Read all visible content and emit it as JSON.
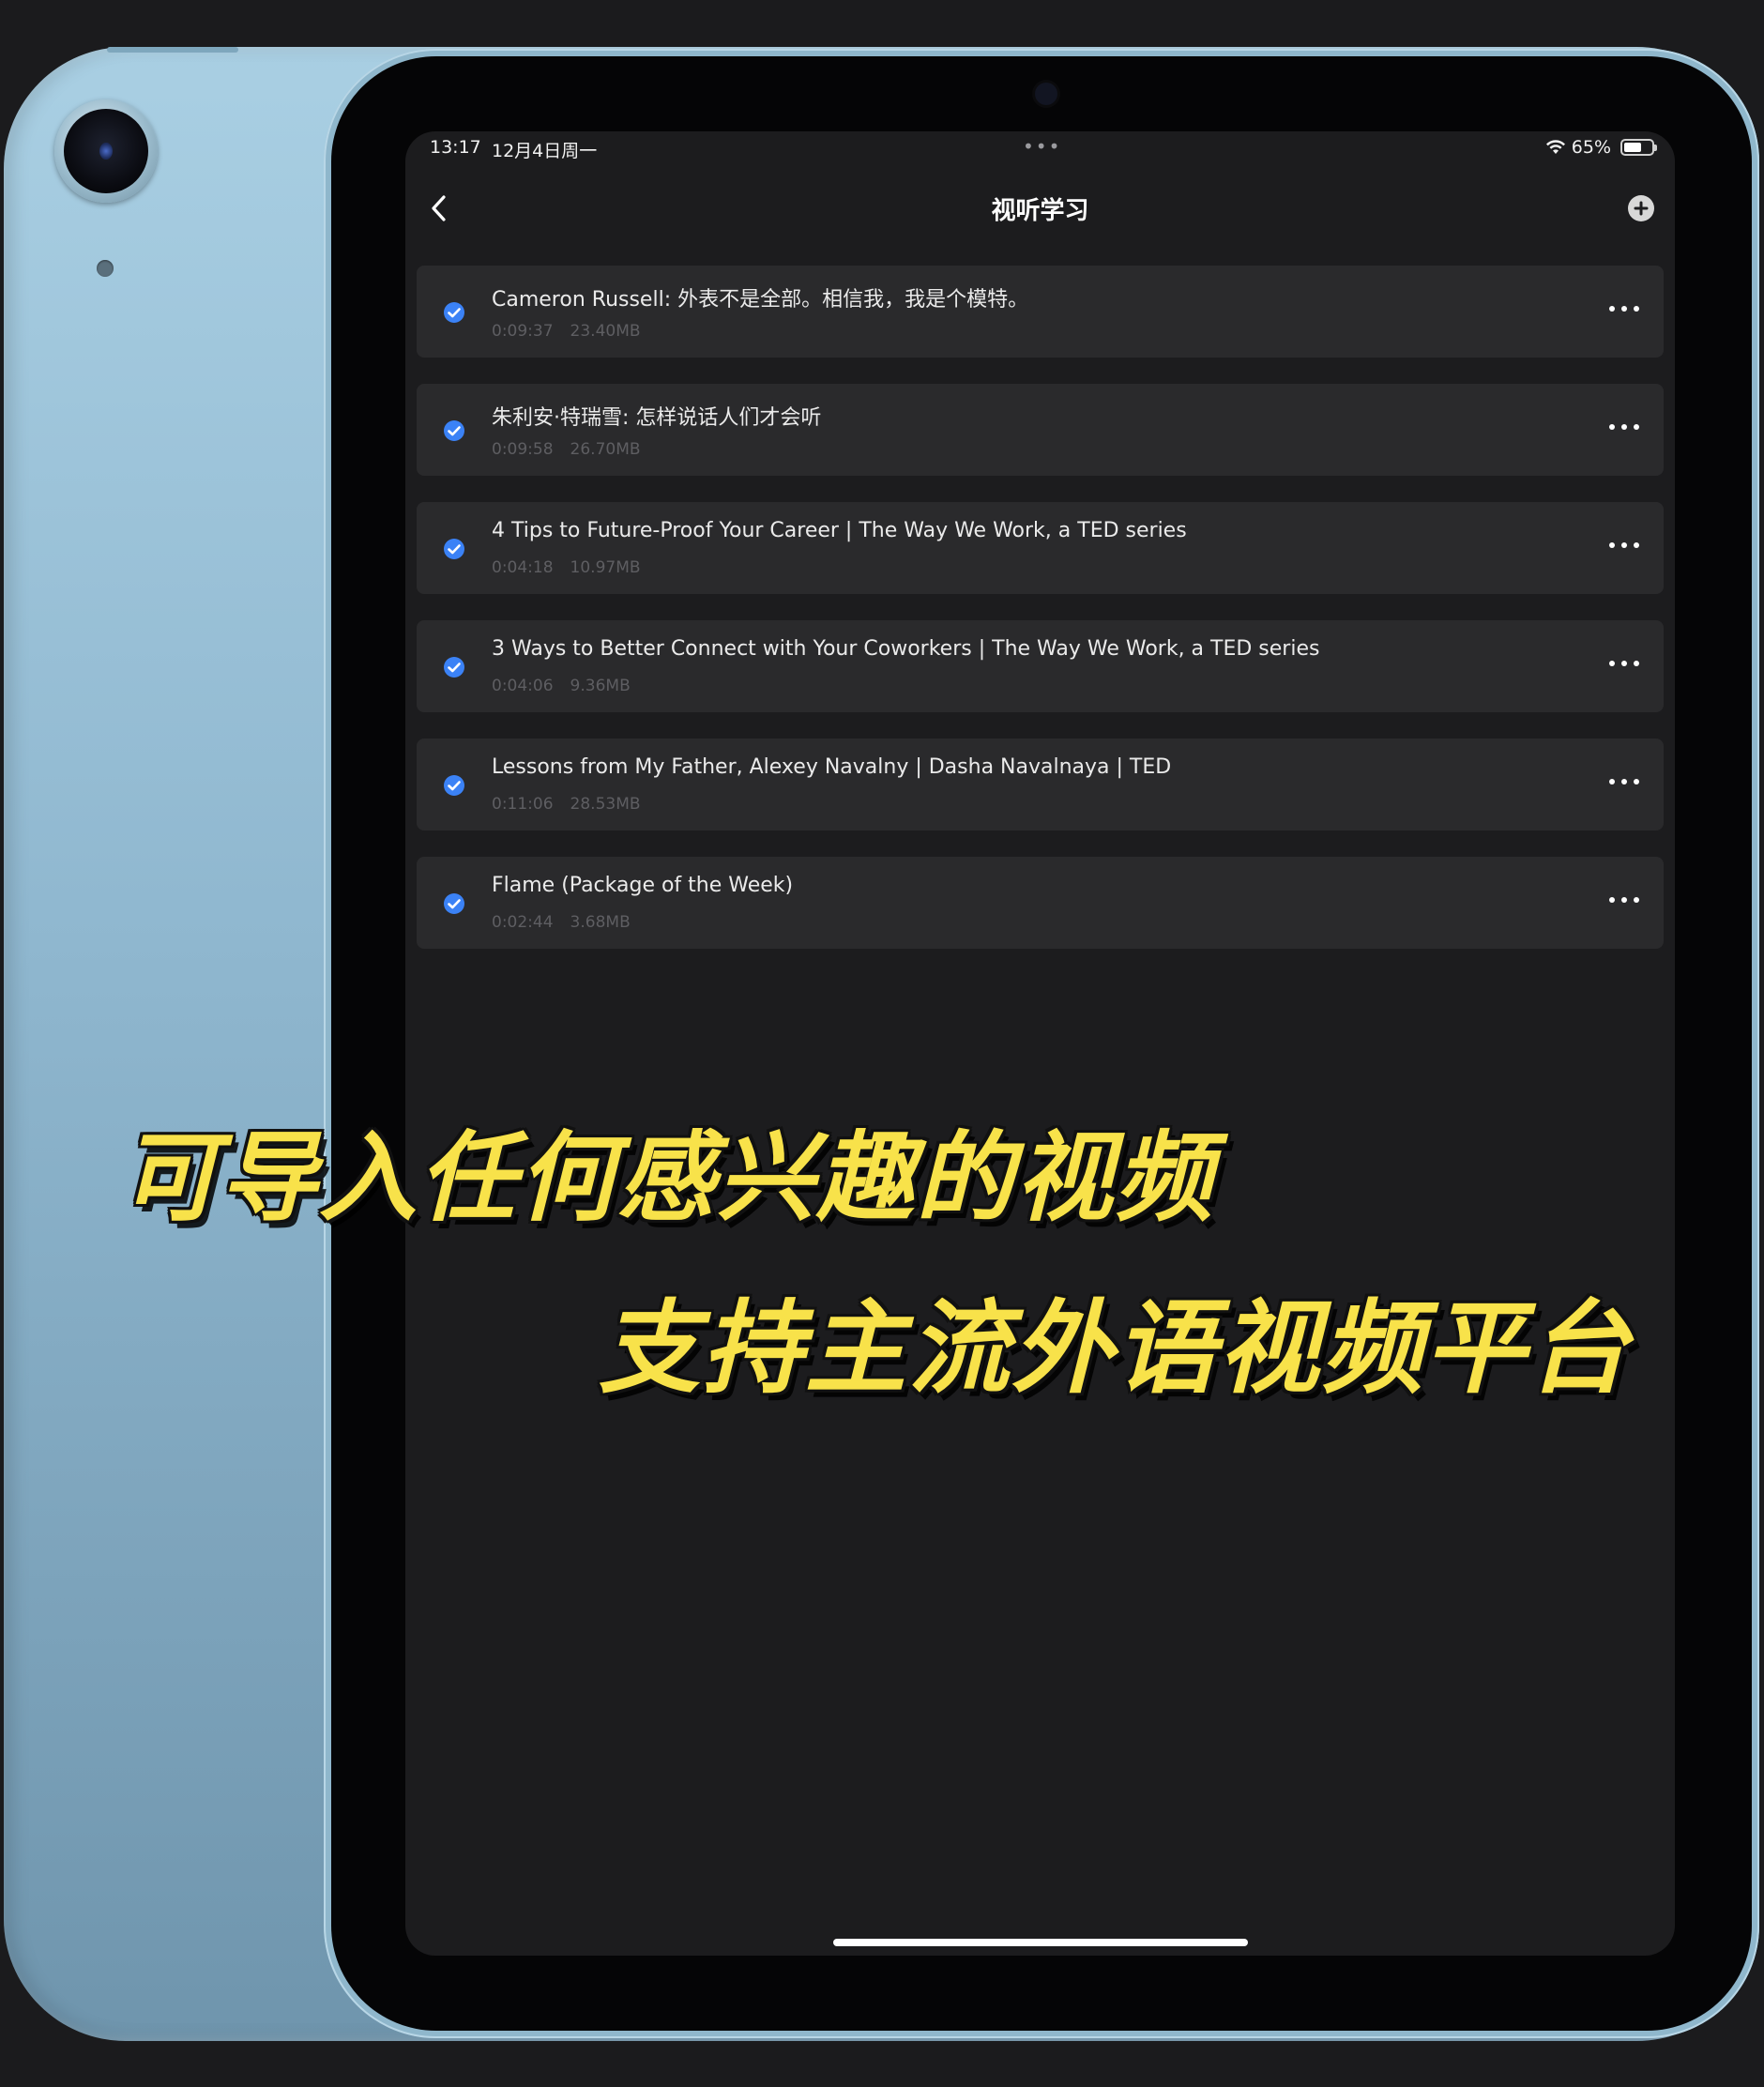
{
  "status_bar": {
    "time": "13:17",
    "date": "12月4日周一",
    "dots": "•••",
    "battery_text": "65%",
    "battery_level": 0.65
  },
  "nav": {
    "title": "视听学习"
  },
  "videos": [
    {
      "title": "Cameron Russell: 外表不是全部。相信我，我是个模特。",
      "duration": "0:09:37",
      "size": "23.40MB",
      "downloaded": true
    },
    {
      "title": "朱利安·特瑞雪: 怎样说话人们才会听",
      "duration": "0:09:58",
      "size": "26.70MB",
      "downloaded": true
    },
    {
      "title": "4 Tips to Future-Proof Your Career | The Way We Work, a TED series",
      "duration": "0:04:18",
      "size": "10.97MB",
      "downloaded": true
    },
    {
      "title": "3 Ways to Better Connect with Your Coworkers | The Way We Work, a TED series",
      "duration": "0:04:06",
      "size": "9.36MB",
      "downloaded": true
    },
    {
      "title": "Lessons from My Father, Alexey Navalny | Dasha Navalnaya |  TED",
      "duration": "0:11:06",
      "size": "28.53MB",
      "downloaded": true
    },
    {
      "title": "Flame (Package of the Week)",
      "duration": "0:02:44",
      "size": "3.68MB",
      "downloaded": true
    }
  ],
  "captions": {
    "line1": "可导入任何感兴趣的视频",
    "line2": "支持主流外语视频平台"
  },
  "colors": {
    "accent_check": "#3b82f6",
    "caption_yellow": "#f8e24a",
    "screen_bg": "#1c1c1e",
    "row_bg": "#2a2a2c",
    "device_blue": "#8fb7cf"
  },
  "icons": {
    "back": "chevron-left-icon",
    "add": "plus-circle-icon",
    "more": "ellipsis-icon",
    "check": "check-circle-icon",
    "wifi": "wifi-icon",
    "battery": "battery-icon"
  }
}
